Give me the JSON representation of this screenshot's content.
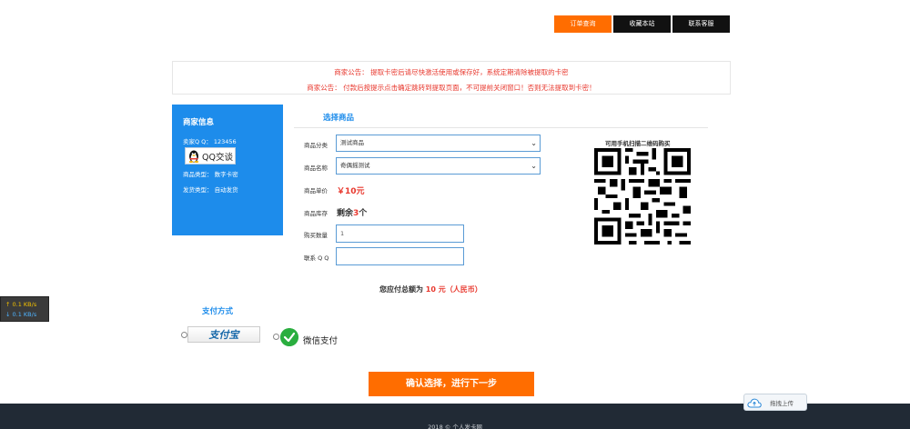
{
  "topnav": {
    "items": [
      {
        "label": "订单查询"
      },
      {
        "label": "收藏本站"
      },
      {
        "label": "联系客服"
      }
    ]
  },
  "notice": {
    "line1": "商家公告： 提取卡密后请尽快激活使用或保存好，系统定期清除被提取的卡密",
    "line2": "商家公告： 付款后按提示点击确定跳转到提取页面，不可提前关闭窗口！否则无法提取到卡密！"
  },
  "merchant": {
    "title": "商家信息",
    "qq": "卖家Q Q：  123456",
    "qq_badge": "QQ交谈",
    "type": "商品类型：  数字卡密",
    "ship": "发货类型：  自动发货"
  },
  "form": {
    "section_title": "选择商品",
    "category_label": "商品分类",
    "category_value": "测试商品",
    "name_label": "商品名称",
    "name_value": "奇偶摇测试",
    "price_label": "商品单价",
    "price_value": "￥10元",
    "stock_label": "商品库存",
    "stock_prefix": "剩余",
    "stock_num": "3",
    "stock_suffix": "个",
    "qty_label": "购买数量",
    "qty_value": "1",
    "contact_label": "联系 Q Q",
    "contact_value": ""
  },
  "qr": {
    "label": "可用手机扫描二维码购买"
  },
  "total": {
    "prefix": "您应付总额为 ",
    "amount": "10",
    "unit": " 元（人民币）"
  },
  "payment": {
    "title": "支付方式",
    "alipay_label": "支付宝",
    "wechat_label": "微信支付"
  },
  "next_button": {
    "label": "确认选择，进行下一步"
  },
  "footer": {
    "copyright": "2018 © 个人发卡网"
  },
  "netspeed": {
    "up": "↑ 0.1 KB/s",
    "down": "↓ 0.1 KB/s"
  },
  "upload": {
    "label": "拖拽上传"
  },
  "colors": {
    "accent": "#ff6d00",
    "blue": "#1d8ceb",
    "red": "#e8382e",
    "footer": "#212a35"
  }
}
